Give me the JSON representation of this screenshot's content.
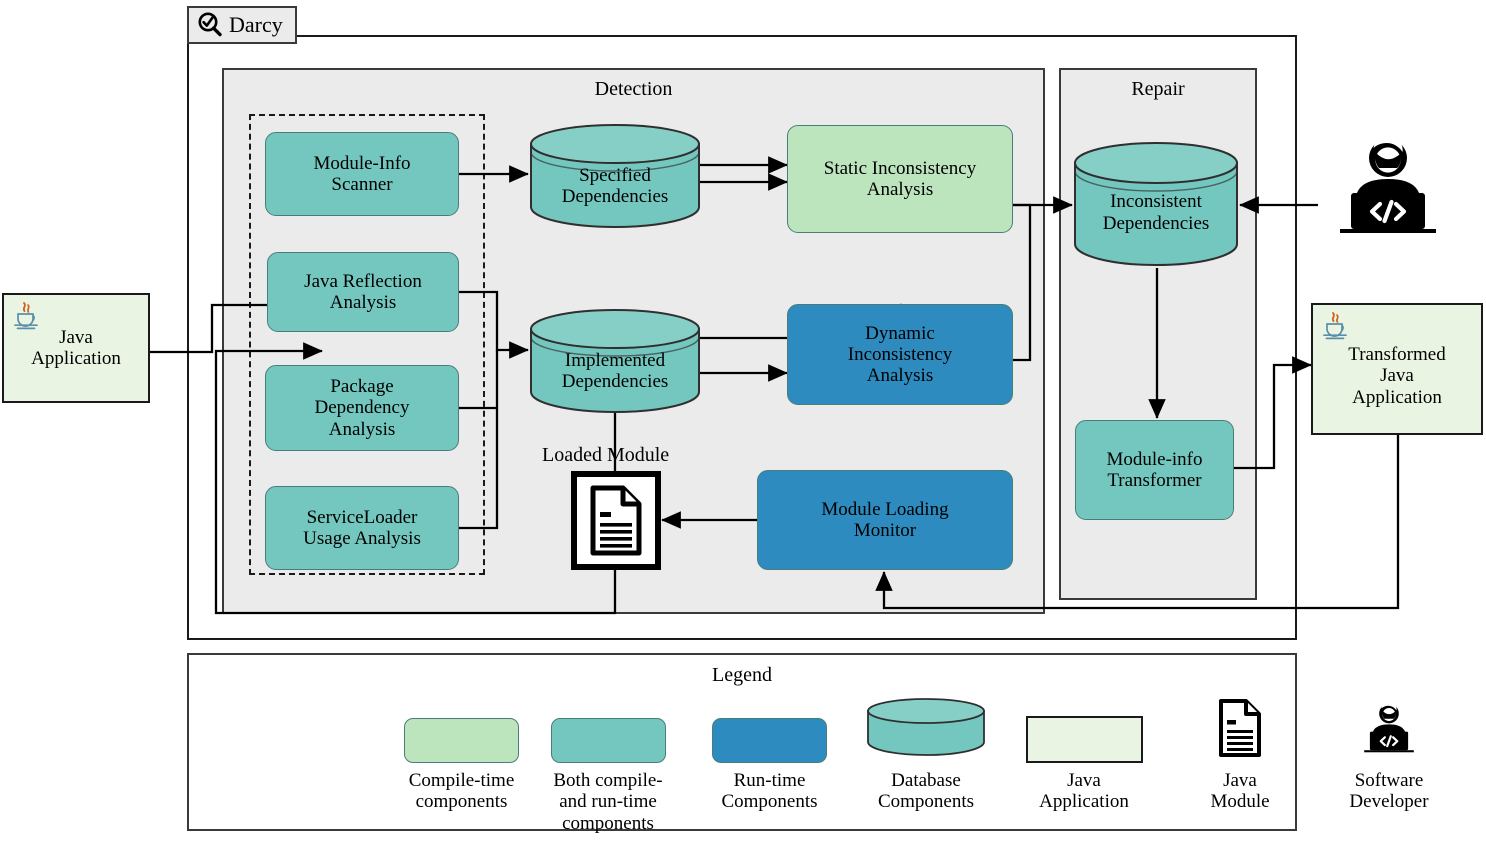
{
  "app": {
    "tab_label": "Darcy",
    "tab_icon": "magnifier-check-icon"
  },
  "panels": {
    "detection": {
      "title": "Detection"
    },
    "repair": {
      "title": "Repair"
    }
  },
  "colors": {
    "teal": "#74c7bf",
    "green": "#bce5bd",
    "blue": "#2d8bbf",
    "java_fill": "#eaf4e2",
    "panel_bg": "#ebebeb",
    "stroke": "#1a1a1a"
  },
  "nodes": {
    "java_application": {
      "label": "Java\nApplication",
      "icon": "java-cup-icon"
    },
    "transformed_java_application": {
      "label": "Transformed\nJava\nApplication",
      "icon": "java-cup-icon"
    },
    "module_info_scanner": {
      "label": "Module-Info\nScanner"
    },
    "java_reflection_analysis": {
      "label": "Java Reflection\nAnalysis"
    },
    "package_dependency_analysis": {
      "label": "Package\nDependency\nAnalysis"
    },
    "serviceloader_usage_analysis": {
      "label": "ServiceLoader\nUsage Analysis"
    },
    "specified_dependencies": {
      "label": "Specified\nDependencies"
    },
    "implemented_dependencies": {
      "label": "Implemented\nDependencies"
    },
    "static_inconsistency_analysis": {
      "label": "Static Inconsistency\nAnalysis"
    },
    "dynamic_inconsistency_analysis": {
      "label": "Dynamic\nInconsistency\nAnalysis"
    },
    "module_loading_monitor": {
      "label": "Module Loading\nMonitor"
    },
    "loaded_module": {
      "label": "Loaded Module",
      "icon": "java-module-document-icon"
    },
    "inconsistent_dependencies": {
      "label": "Inconsistent\nDependencies"
    },
    "module_info_transformer": {
      "label": "Module-info\nTransformer"
    },
    "software_developer": {
      "icon": "software-developer-icon"
    }
  },
  "legend": {
    "title": "Legend",
    "items": [
      {
        "name": "compile-time-components",
        "caption": "Compile-time\ncomponents",
        "swatch": "rounded",
        "color": "#bce5bd"
      },
      {
        "name": "both-compile-and-run-time-components",
        "caption": "Both compile-\nand run-time\ncomponents",
        "swatch": "rounded",
        "color": "#74c7bf"
      },
      {
        "name": "run-time-components",
        "caption": "Run-time\nComponents",
        "swatch": "rounded",
        "color": "#2d8bbf"
      },
      {
        "name": "database-components",
        "caption": "Database\nComponents",
        "swatch": "cylinder",
        "color": "#74c7bf"
      },
      {
        "name": "java-application",
        "caption": "Java\nApplication",
        "swatch": "rect",
        "color": "#eaf4e2"
      },
      {
        "name": "java-module",
        "caption": "Java\nModule",
        "swatch": "document-icon",
        "color": "#1a1a1a"
      },
      {
        "name": "software-developer",
        "caption": "Software\nDeveloper",
        "swatch": "developer-icon",
        "color": "#1a1a1a"
      }
    ]
  }
}
